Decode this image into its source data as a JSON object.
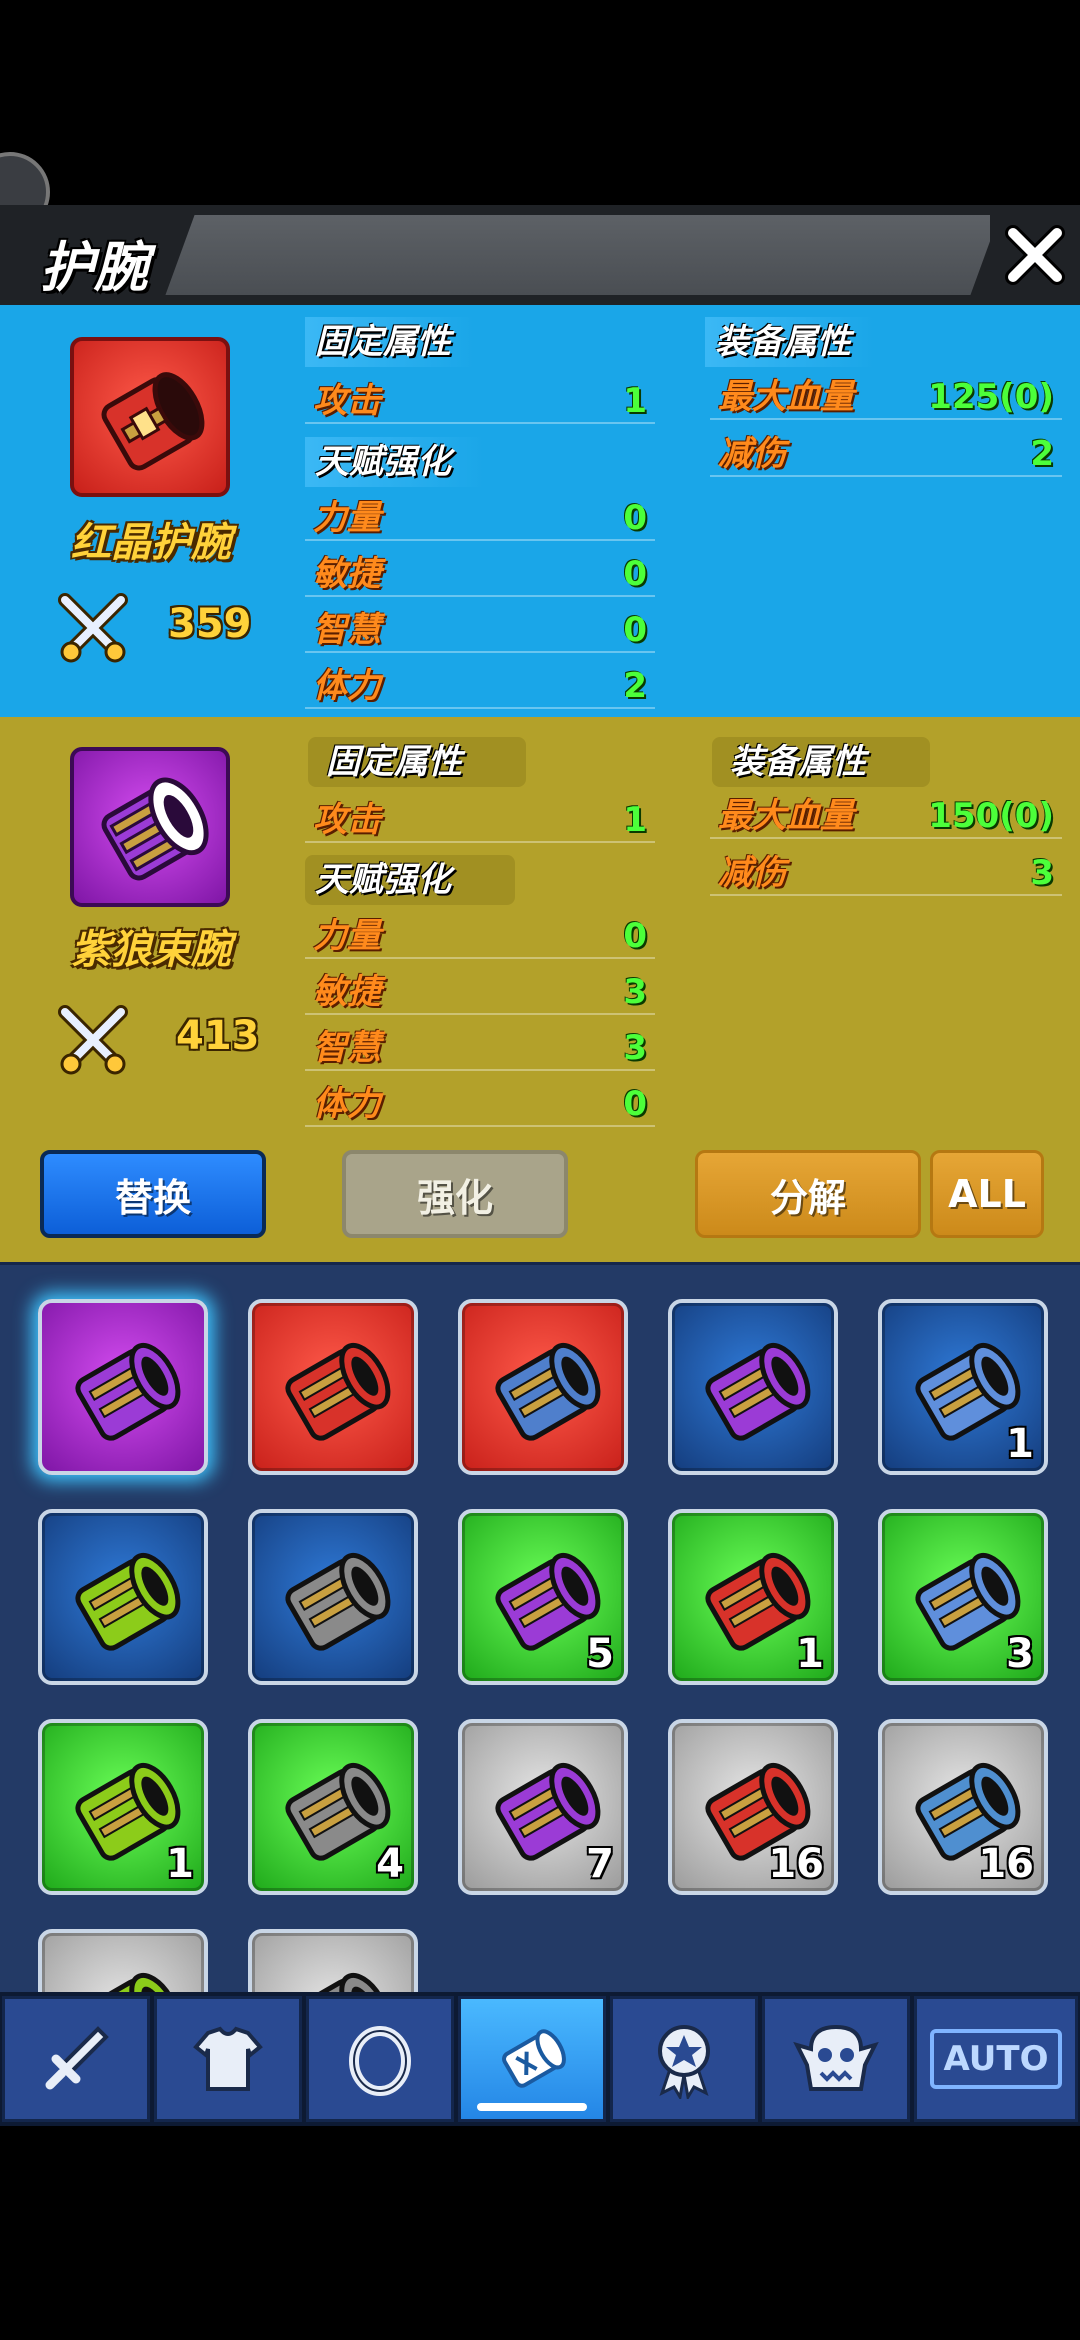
{
  "header": {
    "title": "护腕"
  },
  "current": {
    "name": "红晶护腕",
    "power": "359",
    "fixed_header": "固定属性",
    "fixed": [
      {
        "label": "攻击",
        "value": "1"
      }
    ],
    "talent_header": "天赋强化",
    "talent": [
      {
        "label": "力量",
        "value": "0"
      },
      {
        "label": "敏捷",
        "value": "0"
      },
      {
        "label": "智慧",
        "value": "0"
      },
      {
        "label": "体力",
        "value": "2"
      }
    ],
    "equip_header": "装备属性",
    "equip": [
      {
        "label": "最大血量",
        "value": "125(0)"
      },
      {
        "label": "减伤",
        "value": "2"
      }
    ]
  },
  "candidate": {
    "name": "紫狼束腕",
    "power": "413",
    "fixed_header": "固定属性",
    "fixed": [
      {
        "label": "攻击",
        "value": "1"
      }
    ],
    "talent_header": "天赋强化",
    "talent": [
      {
        "label": "力量",
        "value": "0"
      },
      {
        "label": "敏捷",
        "value": "3"
      },
      {
        "label": "智慧",
        "value": "3"
      },
      {
        "label": "体力",
        "value": "0"
      }
    ],
    "equip_header": "装备属性",
    "equip": [
      {
        "label": "最大血量",
        "value": "150(0)"
      },
      {
        "label": "减伤",
        "value": "3"
      }
    ]
  },
  "actions": {
    "replace": "替换",
    "enhance": "强化",
    "decompose": "分解",
    "all": "ALL"
  },
  "inventory": {
    "rows": [
      [
        {
          "rarity": "purple",
          "color": "#9b3bd6",
          "qty": ""
        },
        {
          "rarity": "red",
          "color": "#d8322a",
          "qty": ""
        },
        {
          "rarity": "red",
          "color": "#4f7fcc",
          "qty": ""
        },
        {
          "rarity": "blue",
          "color": "#9b3bd6",
          "qty": ""
        },
        {
          "rarity": "blue",
          "color": "#5f8fdc",
          "qty": "1"
        }
      ],
      [
        {
          "rarity": "blue",
          "color": "#8ccc1a",
          "qty": ""
        },
        {
          "rarity": "blue",
          "color": "#8a8a8a",
          "qty": ""
        },
        {
          "rarity": "green",
          "color": "#9b3bd6",
          "qty": "5"
        },
        {
          "rarity": "green",
          "color": "#d8322a",
          "qty": "1"
        },
        {
          "rarity": "green",
          "color": "#5f8fdc",
          "qty": "3"
        }
      ],
      [
        {
          "rarity": "green",
          "color": "#8ccc1a",
          "qty": "1"
        },
        {
          "rarity": "green",
          "color": "#8a8a8a",
          "qty": "4"
        },
        {
          "rarity": "gray",
          "color": "#9b3bd6",
          "qty": "7"
        },
        {
          "rarity": "gray",
          "color": "#d8322a",
          "qty": "16"
        },
        {
          "rarity": "gray",
          "color": "#4f8fd0",
          "qty": "16"
        }
      ],
      [
        {
          "rarity": "gray",
          "color": "#8ccc1a",
          "qty": ""
        },
        {
          "rarity": "gray",
          "color": "#8a8a8a",
          "qty": ""
        }
      ]
    ]
  },
  "nav": {
    "tabs": [
      "sword-icon",
      "armor-icon",
      "ring-icon",
      "bracer-icon",
      "medal-icon",
      "monster-icon"
    ],
    "auto_label": "AUTO"
  }
}
